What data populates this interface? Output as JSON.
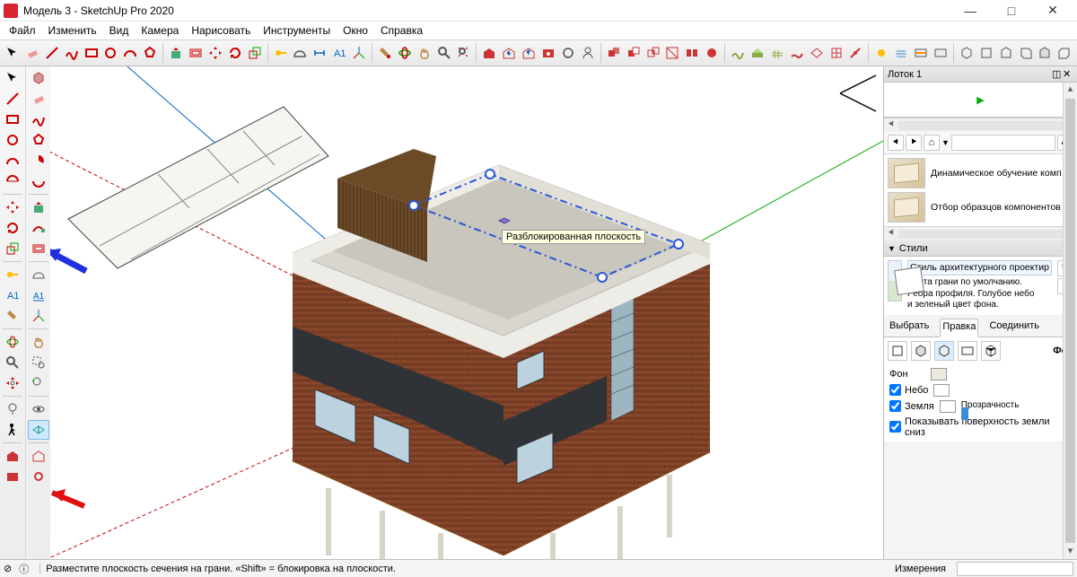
{
  "window": {
    "title": "Модель 3 - SketchUp Pro 2020",
    "minimize": "—",
    "maximize": "□",
    "close": "✕"
  },
  "menu": [
    "Файл",
    "Изменить",
    "Вид",
    "Камера",
    "Нарисовать",
    "Инструменты",
    "Окно",
    "Справка"
  ],
  "viewport": {
    "tooltip": "Разблокированная плоскость"
  },
  "tray": {
    "title": "Лоток 1",
    "components": {
      "items": [
        {
          "label": "Динамическое обучение компоне…"
        },
        {
          "label": "Отбор образцов компонентов"
        }
      ]
    },
    "styles": {
      "header": "Стили",
      "name": "Стиль архитектурного проектир",
      "desc1": "Цвета грани по умолчанию.",
      "desc2": "Ребра профиля. Голубое небо",
      "desc3": "и зеленый цвет фона.",
      "tabs": [
        "Выбрать",
        "Правка",
        "Соединить"
      ],
      "active_tab": 1,
      "fon_label_top": "Фон",
      "bg_label": "Фон",
      "sky_label": "Небо",
      "ground_label": "Земля",
      "transparency_label": "Прозрачность",
      "show_ground_label": "Показывать поверхность земли сниз"
    }
  },
  "status": {
    "hint": "Разместите плоскость сечения на грани. «Shift» = блокировка на плоскости.",
    "meas_label": "Измерения"
  }
}
